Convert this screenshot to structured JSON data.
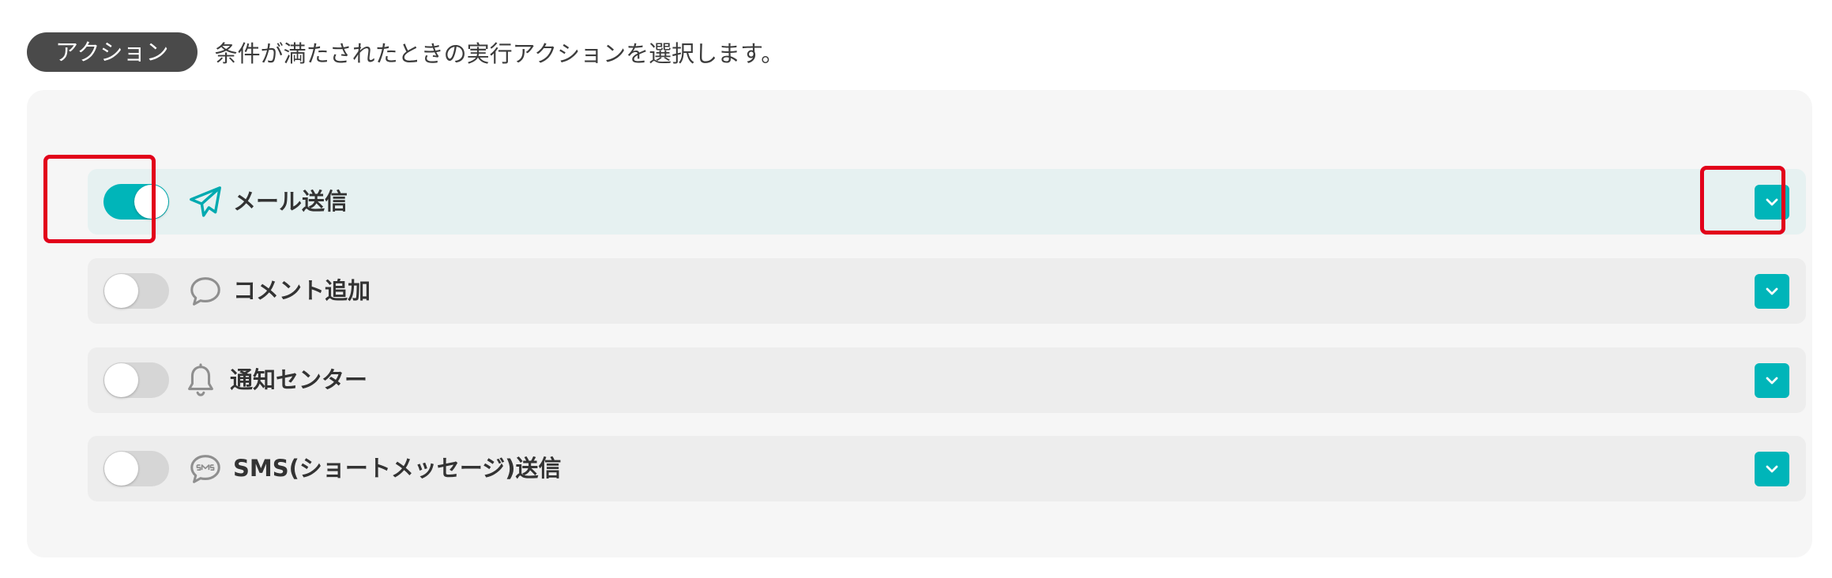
{
  "header": {
    "badge": "アクション",
    "description": "条件が満たされたときの実行アクションを選択します。"
  },
  "actions": [
    {
      "label": "メール送信",
      "enabled": true,
      "icon": "paper-plane-icon"
    },
    {
      "label": "コメント追加",
      "enabled": false,
      "icon": "speech-bubble-icon"
    },
    {
      "label": "通知センター",
      "enabled": false,
      "icon": "bell-icon"
    },
    {
      "label": "SMS(ショートメッセージ)送信",
      "enabled": false,
      "icon": "sms-bubble-icon"
    }
  ],
  "colors": {
    "accent": "#00b5b9",
    "highlight": "#e2001a",
    "badge_bg": "#4a4a4a",
    "active_row_bg": "#e6f1f1",
    "row_bg": "#ededed"
  }
}
